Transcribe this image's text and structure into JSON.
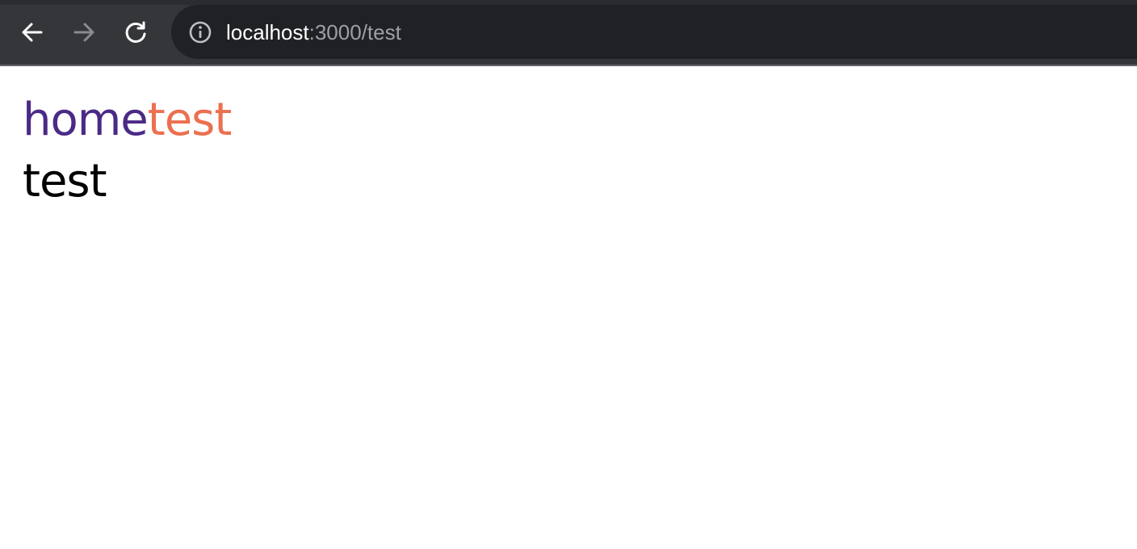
{
  "browser": {
    "url_host": "localhost",
    "url_rest": ":3000/test",
    "icons": {
      "back": "arrow-left-icon",
      "forward": "arrow-right-icon",
      "reload": "reload-icon",
      "site_info": "info-icon"
    }
  },
  "nav": {
    "home_label": "home",
    "test_label": "test",
    "colors": {
      "home": "#4b2a86",
      "test": "#ec7050"
    }
  },
  "main": {
    "heading": "test"
  }
}
